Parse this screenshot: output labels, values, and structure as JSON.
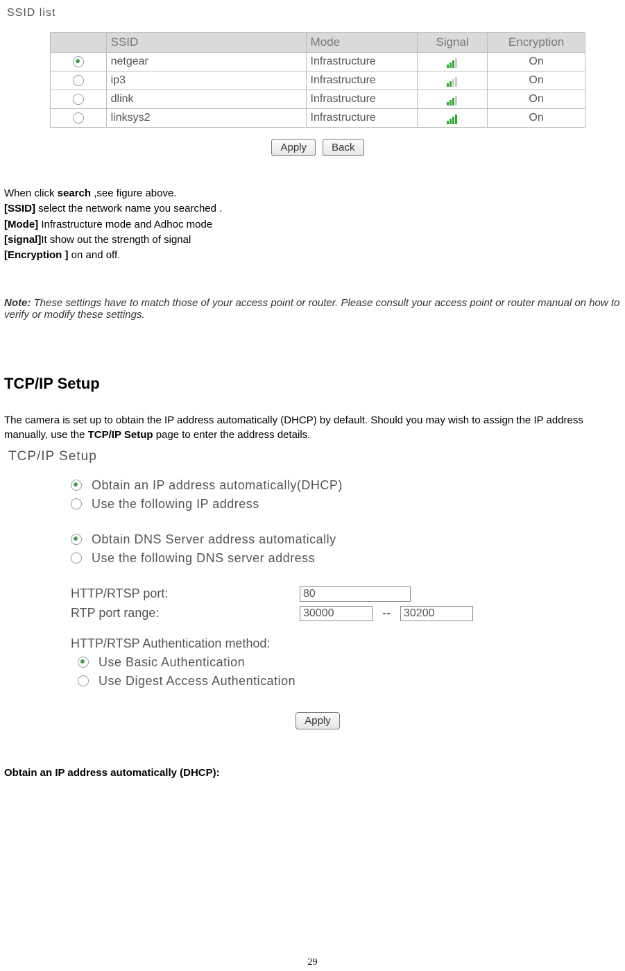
{
  "ssid_title": "SSID list",
  "ssid_headers": {
    "ssid": "SSID",
    "mode": "Mode",
    "signal": "Signal",
    "encryption": "Encryption"
  },
  "ssid_rows": [
    {
      "selected": true,
      "ssid": "netgear",
      "mode": "Infrastructure",
      "signal": 3,
      "enc": "On"
    },
    {
      "selected": false,
      "ssid": "ip3",
      "mode": "Infrastructure",
      "signal": 2,
      "enc": "On"
    },
    {
      "selected": false,
      "ssid": "dlink",
      "mode": "Infrastructure",
      "signal": 3,
      "enc": "On"
    },
    {
      "selected": false,
      "ssid": "linksys2",
      "mode": "Infrastructure",
      "signal": 4,
      "enc": "On"
    }
  ],
  "btn_apply": "Apply",
  "btn_back": "Back",
  "desc": {
    "l1a": "When click ",
    "l1b": "search",
    "l1c": " ,see figure above.",
    "l2a": "[SSID]",
    "l2b": " select the network name you searched .",
    "l3a": "[Mode]",
    "l3b": " Infrastructure mode and Adhoc mode",
    "l4a": "[signal]",
    "l4b": "It show out the strength of signal",
    "l5a": "[Encryption ]",
    "l5b": " on and off."
  },
  "note_label": "Note:",
  "note_body": " These settings have to match those of your access point or router. Please consult your access point or router manual on how to verify or modify these settings.",
  "tcp_heading": "TCP/IP Setup",
  "tcp_intro_a": "The camera is set up to obtain the IP address automatically (DHCP) by default. Should you may wish to assign the IP address manually, use the ",
  "tcp_intro_b": "TCP/IP Setup",
  "tcp_intro_c": " page to enter the address details.",
  "tcp_panel_title": "TCP/IP Setup",
  "tcp": {
    "ip_auto": "Obtain an IP address automatically(DHCP)",
    "ip_manual": "Use the following IP address",
    "dns_auto": "Obtain DNS Server address automatically",
    "dns_manual": "Use the following DNS server address",
    "http_label": "HTTP/RTSP port:",
    "http_value": "80",
    "rtp_label": "RTP port range:",
    "rtp_from": "30000",
    "rtp_dash": "--",
    "rtp_to": "30200",
    "auth_head": "HTTP/RTSP Authentication method:",
    "auth_basic": "Use Basic Authentication",
    "auth_digest": "Use Digest Access Authentication"
  },
  "obtain_heading": "Obtain an IP address automatically (DHCP):",
  "page_number": "29"
}
